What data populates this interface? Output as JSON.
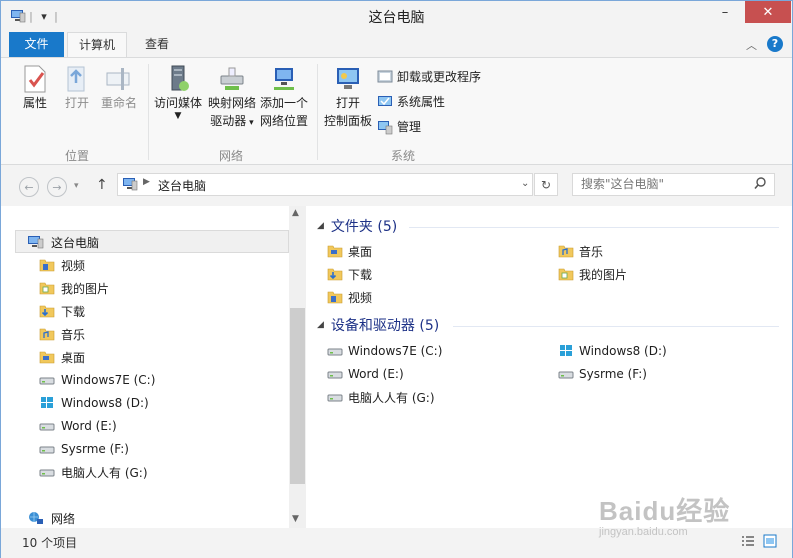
{
  "window": {
    "title": "这台电脑"
  },
  "quick_access": {
    "dropdown": "▾"
  },
  "window_controls": {
    "minimize": "–",
    "maximize": "□",
    "close": "✕"
  },
  "ribbon_tabs": {
    "file": "文件",
    "computer": "计算机",
    "view": "查看"
  },
  "ribbon": {
    "properties": "属性",
    "open": "打开",
    "rename": "重命名",
    "access_media": "访问媒体",
    "map_drive_1": "映射网络",
    "map_drive_2": "驱动器",
    "add_location_1": "添加一个",
    "add_location_2": "网络位置",
    "control_panel_1": "打开",
    "control_panel_2": "控制面板",
    "uninstall": "卸载或更改程序",
    "system_props": "系统属性",
    "manage": "管理",
    "group_location": "位置",
    "group_network": "网络",
    "group_system": "系统"
  },
  "address": {
    "path": "这台电脑",
    "search_placeholder": "搜索\"这台电脑\""
  },
  "nav": {
    "this_pc": "这台电脑",
    "items": [
      "视频",
      "我的图片",
      "下载",
      "音乐",
      "桌面",
      "Windows7E (C:)",
      "Windows8 (D:)",
      "Word (E:)",
      "Sysrme (F:)",
      "电脑人人有 (G:)"
    ],
    "network": "网络"
  },
  "content": {
    "folders_header": "文件夹 (5)",
    "folders": [
      "桌面",
      "音乐",
      "下载",
      "我的图片",
      "视频"
    ],
    "devices_header": "设备和驱动器 (5)",
    "drives": [
      "Windows7E (C:)",
      "Windows8 (D:)",
      "Word (E:)",
      "Sysrme (F:)",
      "电脑人人有 (G:)"
    ]
  },
  "status": {
    "count": "10 个项目"
  },
  "watermark": {
    "brand": "Baidu经验",
    "url": "jingyan.baidu.com"
  },
  "colors": {
    "accent": "#1979ca",
    "group_header": "#1e3287",
    "close": "#c75050"
  }
}
